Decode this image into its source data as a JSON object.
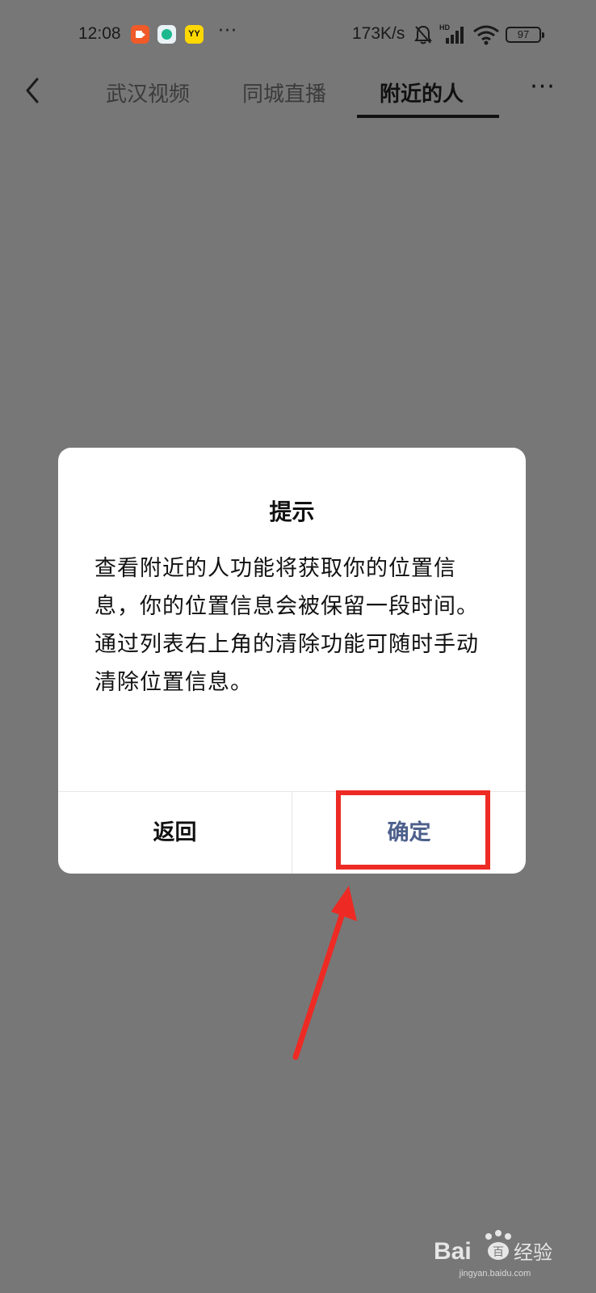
{
  "status_bar": {
    "time": "12:08",
    "more": "···",
    "net_speed": "173K/s",
    "signal_tag": "HD",
    "battery": "97",
    "icons": [
      "video-app-icon",
      "globe-app-icon",
      "yy-app-icon",
      "bell-off-icon",
      "signal-icon",
      "wifi-icon",
      "battery-icon"
    ],
    "yy_label": "YY"
  },
  "nav": {
    "tabs": [
      {
        "label": "武汉视频",
        "active": false
      },
      {
        "label": "同城直播",
        "active": false
      },
      {
        "label": "附近的人",
        "active": true
      }
    ],
    "more": "···"
  },
  "dialog": {
    "title": "提示",
    "body": "查看附近的人功能将获取你的位置信息，你的位置信息会被保留一段时间。通过列表右上角的清除功能可随时手动清除位置信息。",
    "cancel_label": "返回",
    "confirm_label": "确定"
  },
  "annotation": {
    "highlight_color": "#ee2a24"
  },
  "watermark": {
    "brand": "Bai",
    "brand_du": "百",
    "brand_suffix": "经验",
    "url": "jingyan.baidu.com"
  },
  "colors": {
    "overlay": "#777777",
    "dialog_bg": "#ffffff",
    "confirm_text": "#4d5f8c"
  }
}
